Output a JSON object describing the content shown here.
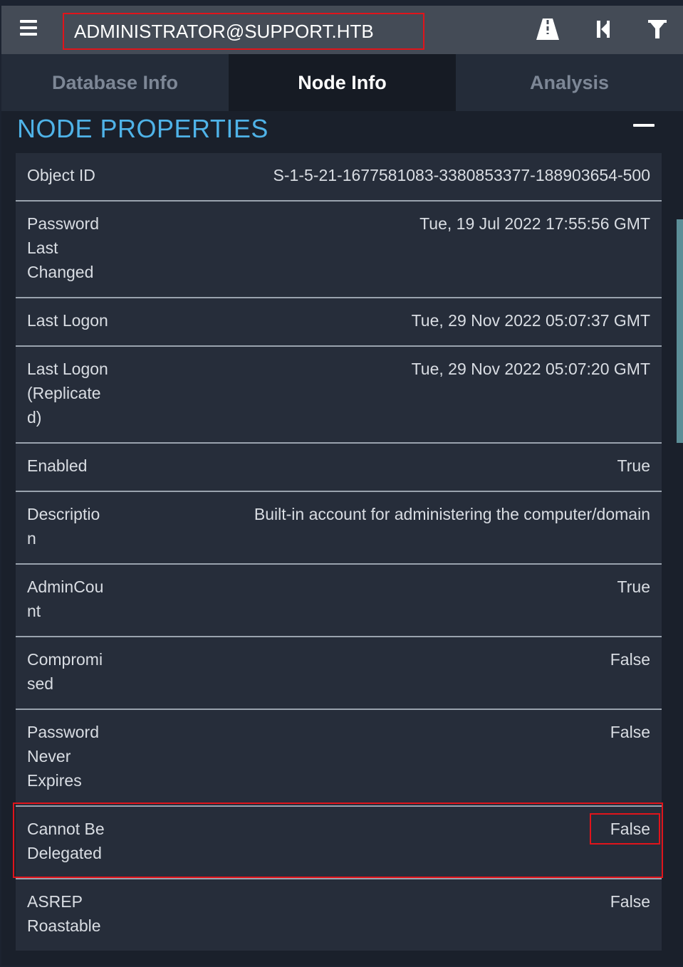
{
  "search": {
    "value": "ADMINISTRATOR@SUPPORT.HTB"
  },
  "toolbar": {
    "menu_icon": "hamburger-menu-icon",
    "path_icon": "road-path-icon",
    "back_icon": "skip-back-icon",
    "filter_icon": "filter-funnel-icon"
  },
  "tabs": [
    {
      "label": "Database Info"
    },
    {
      "label": "Node Info",
      "active": true
    },
    {
      "label": "Analysis"
    }
  ],
  "section": {
    "title": "NODE PROPERTIES",
    "collapse_icon": "minus-icon"
  },
  "properties": [
    {
      "key": "Object ID",
      "value": "S-1-5-21-1677581083-3380853377-188903654-500"
    },
    {
      "key": "Password Last Changed",
      "value": "Tue, 19 Jul 2022 17:55:56 GMT"
    },
    {
      "key": "Last Logon",
      "value": "Tue, 29 Nov 2022 05:07:37 GMT"
    },
    {
      "key": "Last Logon (Replicated)",
      "value": "Tue, 29 Nov 2022 05:07:20 GMT"
    },
    {
      "key": "Enabled",
      "value": "True"
    },
    {
      "key": "Description",
      "value": "Built-in account for administering the computer/domain"
    },
    {
      "key": "AdminCount",
      "value": "True"
    },
    {
      "key": "Compromised",
      "value": "False"
    },
    {
      "key": "Password Never Expires",
      "value": "False"
    },
    {
      "key": "Cannot Be Delegated",
      "value": "False"
    },
    {
      "key": "ASREP Roastable",
      "value": "False"
    }
  ],
  "colors": {
    "accent": "#4fb3e8",
    "highlight": "#e0141b",
    "toolbar_bg": "#444b56",
    "row_bg": "#262d3a"
  }
}
